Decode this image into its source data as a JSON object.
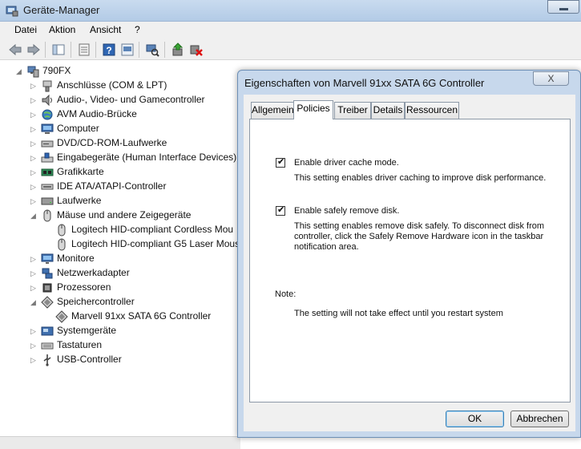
{
  "window": {
    "title": "Geräte-Manager"
  },
  "menu": {
    "items": [
      "Datei",
      "Aktion",
      "Ansicht",
      "?"
    ]
  },
  "toolbar": {
    "icons": [
      "back-icon",
      "forward-icon",
      "show-hide-tree-icon",
      "properties-icon",
      "help-icon",
      "show-hidden-icon",
      "scan-hardware-icon",
      "update-driver-icon",
      "uninstall-icon"
    ]
  },
  "tree": {
    "root": "790FX",
    "items": [
      {
        "label": "Anschlüsse (COM & LPT)",
        "icon": "port-icon",
        "expanded": false
      },
      {
        "label": "Audio-, Video- und Gamecontroller",
        "icon": "speaker-icon",
        "expanded": false
      },
      {
        "label": "AVM Audio-Brücke",
        "icon": "globe-icon",
        "expanded": false
      },
      {
        "label": "Computer",
        "icon": "computer-icon",
        "expanded": false
      },
      {
        "label": "DVD/CD-ROM-Laufwerke",
        "icon": "dvd-drive-icon",
        "expanded": false
      },
      {
        "label": "Eingabegeräte (Human Interface Devices)",
        "icon": "hid-icon",
        "expanded": false
      },
      {
        "label": "Grafikkarte",
        "icon": "display-adapter-icon",
        "expanded": false
      },
      {
        "label": "IDE ATA/ATAPI-Controller",
        "icon": "ide-icon",
        "expanded": false
      },
      {
        "label": "Laufwerke",
        "icon": "disk-drive-icon",
        "expanded": false
      },
      {
        "label": "Mäuse und andere Zeigegeräte",
        "icon": "mouse-icon",
        "expanded": true,
        "children": [
          {
            "label": "Logitech HID-compliant Cordless Mou",
            "icon": "mouse-icon"
          },
          {
            "label": "Logitech HID-compliant G5 Laser Mous",
            "icon": "mouse-icon"
          }
        ]
      },
      {
        "label": "Monitore",
        "icon": "monitor-icon",
        "expanded": false
      },
      {
        "label": "Netzwerkadapter",
        "icon": "network-icon",
        "expanded": false
      },
      {
        "label": "Prozessoren",
        "icon": "processor-icon",
        "expanded": false
      },
      {
        "label": "Speichercontroller",
        "icon": "storage-controller-icon",
        "expanded": true,
        "children": [
          {
            "label": "Marvell 91xx SATA 6G Controller",
            "icon": "storage-controller-icon"
          }
        ]
      },
      {
        "label": "Systemgeräte",
        "icon": "system-device-icon",
        "expanded": false
      },
      {
        "label": "Tastaturen",
        "icon": "keyboard-icon",
        "expanded": false
      },
      {
        "label": "USB-Controller",
        "icon": "usb-icon",
        "expanded": false
      }
    ]
  },
  "dialog": {
    "title": "Eigenschaften von Marvell 91xx SATA 6G Controller",
    "close_label": "X",
    "tabs": [
      "Allgemein",
      "Policies",
      "Treiber",
      "Details",
      "Ressourcen"
    ],
    "active_tab": "Policies",
    "options": [
      {
        "label": "Enable driver cache mode.",
        "checked": true,
        "description": "This setting enables driver caching to improve disk performance."
      },
      {
        "label": "Enable safely remove disk.",
        "checked": true,
        "description_lines": [
          "This setting enables remove disk safely. To disconnect disk from",
          "controller, click the Safely Remove Hardware icon in the taskbar",
          "notification area."
        ]
      }
    ],
    "note_label": "Note:",
    "note_text": "The setting will not take effect until you restart system",
    "ok_label": "OK",
    "cancel_label": "Abbrechen"
  }
}
